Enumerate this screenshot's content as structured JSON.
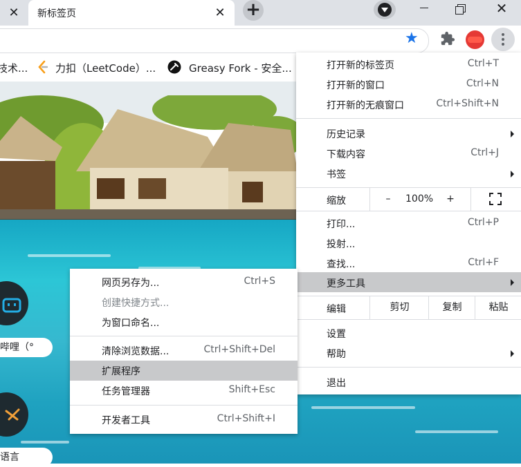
{
  "tabs": [
    {
      "title": ""
    },
    {
      "title": "新标签页"
    }
  ],
  "bookmarks": [
    {
      "label": "技术..."
    },
    {
      "label": "力扣（LeetCode）..."
    },
    {
      "label": "Greasy Fork - 安全..."
    }
  ],
  "page": {
    "shortcuts": [
      {
        "label": "哔哩（°"
      },
      {
        "label": "语言"
      }
    ]
  },
  "menu": {
    "new_tab": {
      "label": "打开新的标签页",
      "shortcut": "Ctrl+T"
    },
    "new_window": {
      "label": "打开新的窗口",
      "shortcut": "Ctrl+N"
    },
    "new_incognito": {
      "label": "打开新的无痕窗口",
      "shortcut": "Ctrl+Shift+N"
    },
    "history": {
      "label": "历史记录"
    },
    "downloads": {
      "label": "下载内容",
      "shortcut": "Ctrl+J"
    },
    "bookmarks": {
      "label": "书签"
    },
    "zoom": {
      "label": "缩放",
      "minus": "–",
      "value": "100%",
      "plus": "+"
    },
    "print": {
      "label": "打印...",
      "shortcut": "Ctrl+P"
    },
    "cast": {
      "label": "投射..."
    },
    "find": {
      "label": "查找...",
      "shortcut": "Ctrl+F"
    },
    "more_tools": {
      "label": "更多工具"
    },
    "edit": {
      "label": "编辑",
      "cut": "剪切",
      "copy": "复制",
      "paste": "粘贴"
    },
    "settings": {
      "label": "设置"
    },
    "help": {
      "label": "帮助"
    },
    "exit": {
      "label": "退出"
    }
  },
  "submenu": {
    "save_as": {
      "label": "网页另存为...",
      "shortcut": "Ctrl+S"
    },
    "create_shortcut": {
      "label": "创建快捷方式..."
    },
    "name_window": {
      "label": "为窗口命名..."
    },
    "clear_data": {
      "label": "清除浏览数据...",
      "shortcut": "Ctrl+Shift+Del"
    },
    "extensions": {
      "label": "扩展程序"
    },
    "task_manager": {
      "label": "任务管理器",
      "shortcut": "Shift+Esc"
    },
    "dev_tools": {
      "label": "开发者工具",
      "shortcut": "Ctrl+Shift+I"
    }
  },
  "colors": {
    "accent": "#1a73e8",
    "highlight": "#c8c9cb",
    "tabstrip": "#dee1e6"
  },
  "icons": {
    "star": "star-icon",
    "extensions": "puzzle-icon",
    "menu": "kebab-icon"
  }
}
